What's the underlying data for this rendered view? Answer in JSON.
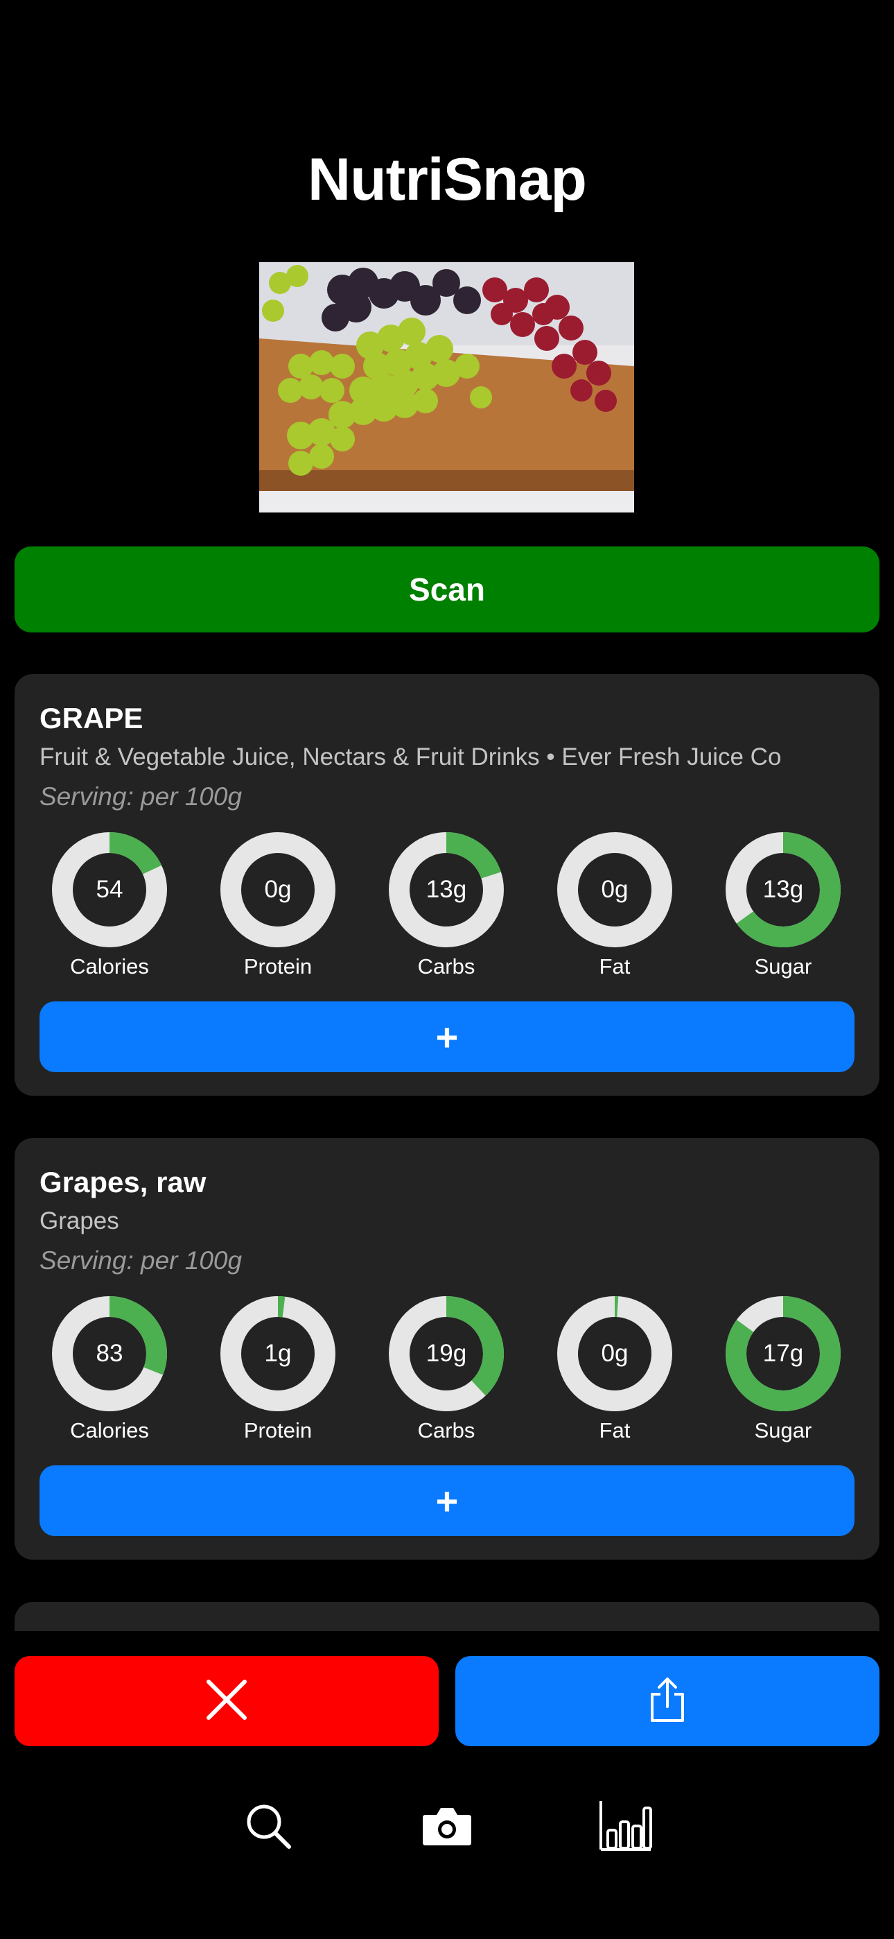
{
  "app": {
    "title": "NutriSnap"
  },
  "photo": {
    "subject": "grapes on wooden cutting board"
  },
  "scan_button": {
    "label": "Scan"
  },
  "colors": {
    "accent_green": "#008000",
    "ring_fill": "#4caf50",
    "ring_track": "#e6e6e6",
    "accent_blue": "#0a7aff",
    "danger_red": "#ff0000",
    "card_bg": "#232323"
  },
  "results": [
    {
      "title": "GRAPE",
      "subtitle": "Fruit & Vegetable Juice, Nectars & Fruit Drinks • Ever Fresh Juice Co",
      "serving": "Serving: per 100g",
      "add_label": "+",
      "nutrients": [
        {
          "label": "Calories",
          "value": "54",
          "fraction": 0.18
        },
        {
          "label": "Protein",
          "value": "0g",
          "fraction": 0.0
        },
        {
          "label": "Carbs",
          "value": "13g",
          "fraction": 0.2
        },
        {
          "label": "Fat",
          "value": "0g",
          "fraction": 0.0
        },
        {
          "label": "Sugar",
          "value": "13g",
          "fraction": 0.65
        }
      ]
    },
    {
      "title": "Grapes, raw",
      "subtitle": "Grapes",
      "serving": "Serving: per 100g",
      "add_label": "+",
      "nutrients": [
        {
          "label": "Calories",
          "value": "83",
          "fraction": 0.31
        },
        {
          "label": "Protein",
          "value": "1g",
          "fraction": 0.02
        },
        {
          "label": "Carbs",
          "value": "19g",
          "fraction": 0.38
        },
        {
          "label": "Fat",
          "value": "0g",
          "fraction": 0.01
        },
        {
          "label": "Sugar",
          "value": "17g",
          "fraction": 0.85
        }
      ]
    }
  ],
  "actions": {
    "close_icon": "close-icon",
    "share_icon": "share-icon"
  },
  "tabbar": {
    "items": [
      {
        "icon": "search-icon"
      },
      {
        "icon": "camera-icon"
      },
      {
        "icon": "bar-chart-icon"
      }
    ]
  }
}
